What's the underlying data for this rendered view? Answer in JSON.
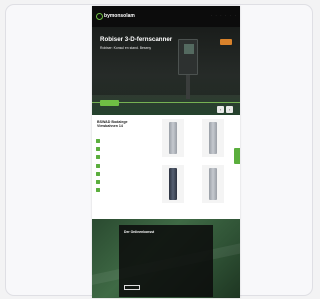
{
  "colors": {
    "accent": "#6fbe44",
    "dark": "#0c0c0c",
    "badge": "#d9822b"
  },
  "nav": {
    "logo_prefix": "b",
    "logo_accent": "",
    "logo_text": "ymonsolam",
    "links": [
      "·",
      "·",
      "·",
      "·",
      "·",
      "·"
    ]
  },
  "hero": {
    "title": "Robiser 3-D-fernscanner",
    "subtitle": "Robiser: Konsul en stand. Beseny",
    "lines": [
      "",
      "",
      "",
      "",
      "",
      ""
    ],
    "button": "",
    "badge": "",
    "arrows": [
      "‹",
      "›"
    ]
  },
  "products": {
    "title": "BSWAD Bodalege Viewbahnen 14",
    "features": [
      "",
      "",
      "",
      "",
      "",
      "",
      ""
    ]
  },
  "bottom": {
    "title": "Der Onlinenkonsst",
    "lines": [
      "",
      "",
      "",
      "",
      "",
      "",
      "",
      "",
      "",
      "",
      "",
      "",
      ""
    ],
    "button": ""
  }
}
